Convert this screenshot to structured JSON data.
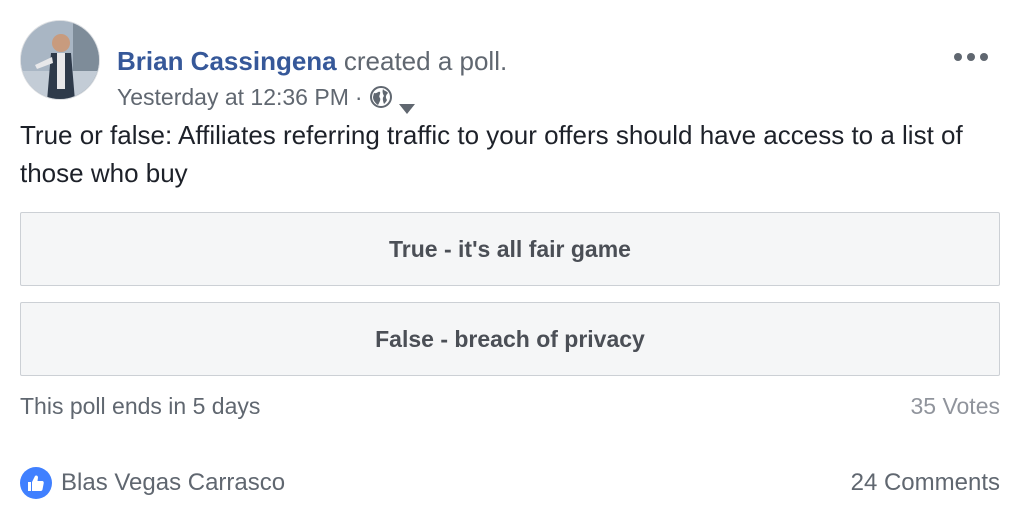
{
  "post": {
    "author": "Brian Cassingena",
    "action": "created a poll.",
    "timestamp": "Yesterday at 12:36 PM",
    "separator": "·",
    "audience_icon": "globe-icon",
    "question": "True or false: Affiliates referring traffic to your offers should have access to a list of those who buy"
  },
  "poll": {
    "options": [
      {
        "label": "True - it's all fair game"
      },
      {
        "label": "False - breach of privacy"
      }
    ],
    "ends_text": "This poll ends in 5 days",
    "votes_text": "35 Votes"
  },
  "reactions": {
    "icon": "like-icon",
    "names": "Blas Vegas Carrasco",
    "comments_text": "24 Comments"
  },
  "colors": {
    "author_link": "#365899",
    "secondary_text": "#606770",
    "like_blue": "#4080ff",
    "option_bg": "#f5f6f7",
    "option_border": "#ccd0d5"
  }
}
